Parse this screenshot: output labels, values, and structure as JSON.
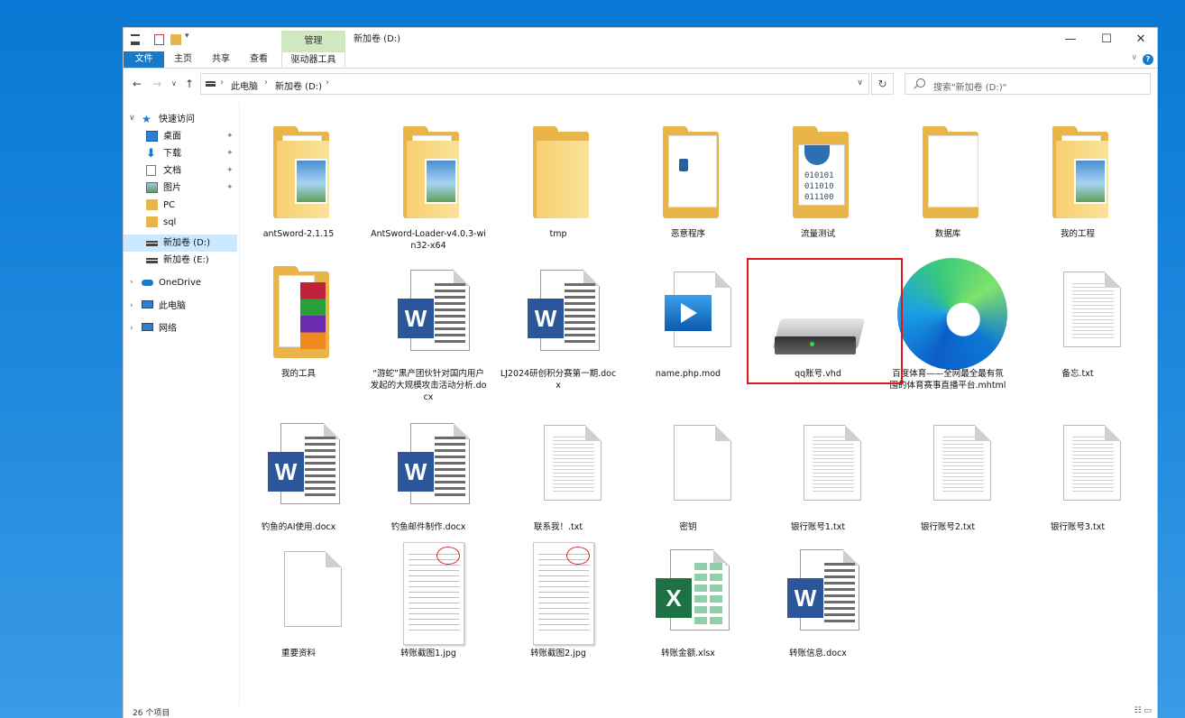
{
  "window": {
    "title": "新加卷 (D:)",
    "context_tab": "管理",
    "controls": {
      "minimize": "—",
      "maximize": "☐",
      "close": "✕"
    }
  },
  "ribbon": {
    "tabs": [
      "文件",
      "主页",
      "共享",
      "查看",
      "驱动器工具"
    ]
  },
  "address": {
    "crumbs": [
      "此电脑",
      "新加卷 (D:)"
    ],
    "search_placeholder": "搜索\"新加卷 (D:)\""
  },
  "nav": {
    "quick_access": "快速访问",
    "quick_items": [
      "桌面",
      "下载",
      "文档",
      "图片",
      "PC",
      "sql",
      "新加卷 (D:)",
      "新加卷 (E:)"
    ],
    "onedrive": "OneDrive",
    "this_pc": "此电脑",
    "network": "网络"
  },
  "files": [
    {
      "name": "antSword-2.1.15",
      "type": "folder-doc"
    },
    {
      "name": "AntSword-Loader-v4.0.3-win32-x64",
      "type": "folder-doc"
    },
    {
      "name": "tmp",
      "type": "folder"
    },
    {
      "name": "恶意程序",
      "type": "folder-app"
    },
    {
      "name": "流量测试",
      "type": "folder-bin"
    },
    {
      "name": "数据库",
      "type": "folder-blank"
    },
    {
      "name": "我的工程",
      "type": "folder-doc"
    },
    {
      "name": "我的工具",
      "type": "folder-books"
    },
    {
      "name": "“游蛇”黑产团伙针对国内用户发起的大规模攻击活动分析.docx",
      "type": "word"
    },
    {
      "name": "LJ2024研创积分赛第一期.docx",
      "type": "word"
    },
    {
      "name": "name.php.mod",
      "type": "video"
    },
    {
      "name": "qq账号.vhd",
      "type": "vhd"
    },
    {
      "name": "百度体育——全网最全最有氛围的体育赛事直播平台.mhtml",
      "type": "edge"
    },
    {
      "name": "备忘.txt",
      "type": "txt"
    },
    {
      "name": "钓鱼的AI使用.docx",
      "type": "word"
    },
    {
      "name": "钓鱼邮件制作.docx",
      "type": "word"
    },
    {
      "name": "联系我！.txt",
      "type": "txt"
    },
    {
      "name": "密钥",
      "type": "blank"
    },
    {
      "name": "银行账号1.txt",
      "type": "txt"
    },
    {
      "name": "银行账号2.txt",
      "type": "txt"
    },
    {
      "name": "银行账号3.txt",
      "type": "txt"
    },
    {
      "name": "重要资料",
      "type": "blank"
    },
    {
      "name": "转账截图1.jpg",
      "type": "receipt"
    },
    {
      "name": "转账截图2.jpg",
      "type": "receipt"
    },
    {
      "name": "转账金额.xlsx",
      "type": "excel"
    },
    {
      "name": "转账信息.docx",
      "type": "word"
    }
  ],
  "binary_text": [
    "010101",
    "011010",
    "011100"
  ],
  "status": {
    "count": "26 个项目"
  },
  "icons": {
    "word": "W",
    "excel": "X"
  },
  "colors": {
    "accent": "#1979ca",
    "selection": "#e0161b",
    "folder": "#e9b548"
  }
}
